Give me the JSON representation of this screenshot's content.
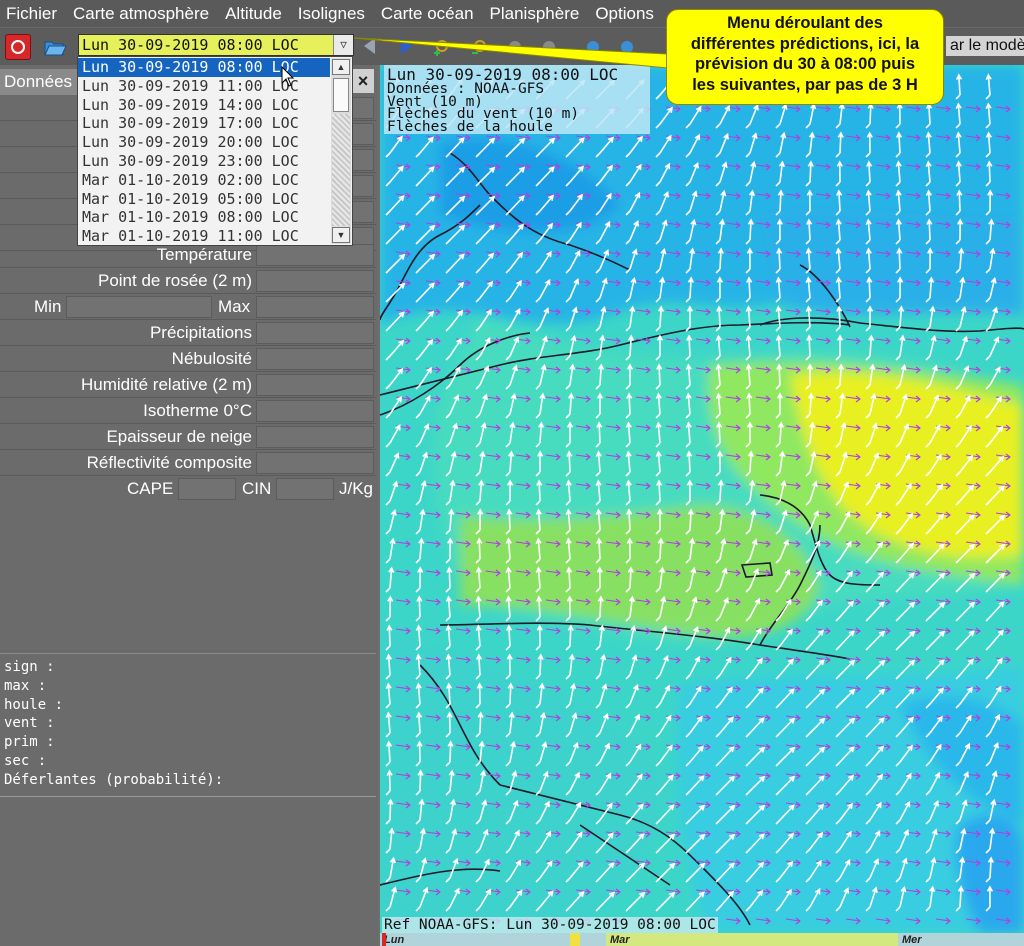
{
  "menubar": {
    "items": [
      "Fichier",
      "Carte atmosphère",
      "Altitude",
      "Isolignes",
      "Carte océan",
      "Planisphère",
      "Options"
    ]
  },
  "toolbar": {
    "date_value": "Lun 30-09-2019 08:00 LOC",
    "model_label": "ar le modèl"
  },
  "dropdown": {
    "options": [
      "Lun 30-09-2019 08:00 LOC",
      "Lun 30-09-2019 11:00 LOC",
      "Lun 30-09-2019 14:00 LOC",
      "Lun 30-09-2019 17:00 LOC",
      "Lun 30-09-2019 20:00 LOC",
      "Lun 30-09-2019 23:00 LOC",
      "Mar 01-10-2019 02:00 LOC",
      "Mar 01-10-2019 05:00 LOC",
      "Mar 01-10-2019 08:00 LOC",
      "Mar 01-10-2019 11:00 LOC"
    ],
    "selected_index": 0
  },
  "callout": {
    "lines": [
      "Menu déroulant des",
      "différentes prédictions, ici, la",
      "prévision du 30 à 08:00 puis",
      "les suivantes, par pas de 3 H"
    ]
  },
  "panel": {
    "tab_label": "Données",
    "close_label": "×",
    "rows": {
      "temperature": "Température",
      "dew_point": "Point de rosée (2 m)",
      "min": "Min",
      "max": "Max",
      "precip": "Précipitations",
      "nebulosity": "Nébulosité",
      "humidity": "Humidité relative (2 m)",
      "isotherm": "Isotherme 0°C",
      "snow": "Epaisseur de neige",
      "reflectivity": "Réflectivité composite",
      "cape": "CAPE",
      "cin": "CIN",
      "unit": "J/Kg"
    },
    "wave_info": [
      "sign :",
      "max :",
      "houle :",
      "vent :",
      "prim :",
      "sec :",
      "Déferlantes (probabilité):"
    ]
  },
  "map": {
    "info_title": "Lun 30-09-2019 08:00 LOC",
    "info_lines": [
      "Données : NOAA-GFS",
      "Vent (10 m)",
      "Flèches du vent (10 m)",
      "Flèches de la houle"
    ],
    "ref_line": "Ref NOAA-GFS: Lun 30-09-2019 08:00 LOC"
  },
  "timeline": {
    "days": [
      "Lun",
      "Mar",
      "Mer"
    ]
  },
  "colors": {
    "date_combo_bg": "#e6f05a",
    "selected_option": "#1565c0",
    "callout_bg": "#ffff00",
    "quit_button": "#d62828",
    "wind_arrow": "#ffffff",
    "swell_arrow": "#b040e0"
  }
}
